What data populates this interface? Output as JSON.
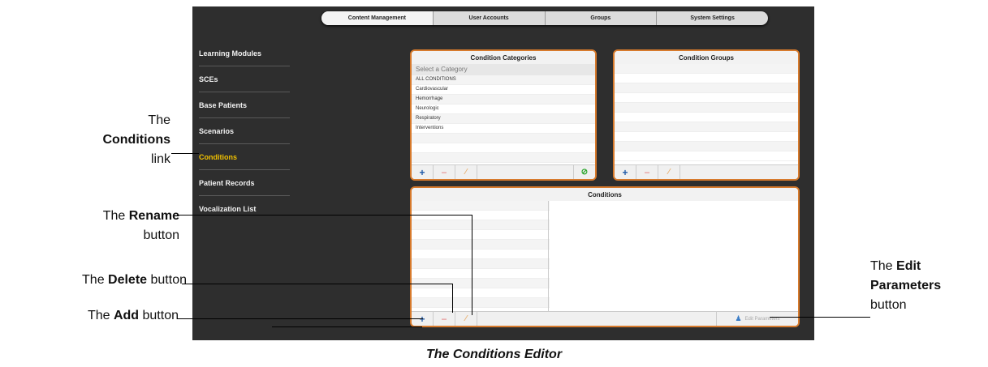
{
  "topnav": {
    "tabs": [
      "Content Management",
      "User Accounts",
      "Groups",
      "System Settings"
    ]
  },
  "sidebar": {
    "items": [
      "Learning Modules",
      "SCEs",
      "Base Patients",
      "Scenarios",
      "Conditions",
      "Patient Records",
      "Vocalization List"
    ]
  },
  "categories_panel": {
    "title": "Condition Categories",
    "placeholder": "Select a Category",
    "rows": [
      "ALL CONDITIONS",
      "Cardiovascular",
      "Hemorrhage",
      "Neurologic",
      "Respiratory",
      "Interventions"
    ]
  },
  "groups_panel": {
    "title": "Condition Groups"
  },
  "conditions_panel": {
    "title": "Conditions",
    "edit_params_label": "Edit Parameters"
  },
  "toolbar": {
    "add": "+",
    "delete": "−",
    "rename": "⁄",
    "ok": "⊘",
    "edit_icon": "info-person-icon"
  },
  "annotations": {
    "conditions": {
      "prefix": "The",
      "bold": "Conditions",
      "suffix": "link"
    },
    "rename": {
      "prefix": "The ",
      "bold": "Rename",
      "suffix": "button"
    },
    "delete": {
      "prefix": "The ",
      "bold": "Delete",
      "suffix": " button"
    },
    "add": {
      "prefix": "The ",
      "bold": "Add",
      "suffix": " button"
    },
    "edit": {
      "prefix": "The ",
      "bold": "Edit",
      "bold2": "Parameters",
      "suffix": "button"
    }
  },
  "caption": "The Conditions Editor",
  "colors": {
    "panel_border": "#d77a2c",
    "active_link": "#f0c000",
    "screen_bg": "#2e2e2e"
  }
}
